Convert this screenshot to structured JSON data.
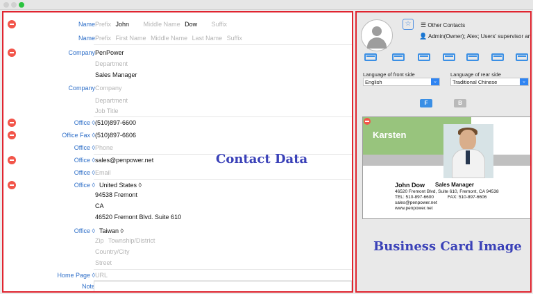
{
  "titlebar": {
    "buttons": [
      "close",
      "minimize",
      "zoom"
    ]
  },
  "left": {
    "rows": [
      {
        "label": "Name",
        "prefix_ph": "Prefix",
        "first": "John",
        "middle_ph": "Middle Name",
        "last": "Dow",
        "suffix_ph": "Suffix"
      },
      {
        "label": "Name",
        "line": [
          "Prefix",
          "First Name",
          "Middle Name",
          "Last Name",
          "Suffix"
        ]
      },
      {
        "label": "Company",
        "company": "PenPower",
        "department_ph": "Department",
        "job": "Sales Manager"
      },
      {
        "label": "Company",
        "company_ph": "Company",
        "department_ph": "Department",
        "job_ph": "Job Title"
      },
      {
        "label": "Office ◊",
        "value": "(510)897-6600"
      },
      {
        "label": "Office Fax ◊",
        "value": "(510)897-6606"
      },
      {
        "label": "Office ◊",
        "placeholder": "Phone"
      },
      {
        "label": "Office ◊",
        "value": "sales@penpower.net"
      },
      {
        "label": "Office ◊",
        "placeholder": "Email"
      },
      {
        "label": "Office ◊",
        "country": "United States ◊",
        "zip_city": "94538  Fremont",
        "state": "CA",
        "street": "46520 Fremont Blvd. Suite 610"
      },
      {
        "label": "Office ◊",
        "country": "Taiwan ◊",
        "zip_ph": "Zip",
        "district_ph": "Township/District",
        "city_ph": "Country/City",
        "street_ph": "Street"
      },
      {
        "label": "Home Page ◊",
        "placeholder": "URL"
      },
      {
        "label": "Note"
      }
    ],
    "overlay_title": "Contact Data"
  },
  "right": {
    "other_contacts": "Other Contacts",
    "admin_text": "Admin(Owner); Alex; Users' supervisor and",
    "front_label": "Language of front side",
    "rear_label": "Language of rear side",
    "front_value": "English",
    "rear_value": "Traditional Chinese",
    "f_button": "F",
    "b_button": "B",
    "overlay_title": "Business Card Image",
    "card": {
      "company": "Karsten",
      "name": "John Dow",
      "title": "Sales Manager",
      "address": "46520 Fremont Blvd, Suite 610, Fremont, CA 94538",
      "phone": "TEL: 510-897-6600",
      "fax": "FAX: 510-897-6606",
      "email": "sales@penpower.net",
      "web": "www.penpower.net"
    }
  },
  "colors": {
    "accent_blue": "#2d6ec8",
    "overlay_blue": "#3a41b8",
    "highlight_red": "#e0242f",
    "minus_red": "#f2554a"
  }
}
